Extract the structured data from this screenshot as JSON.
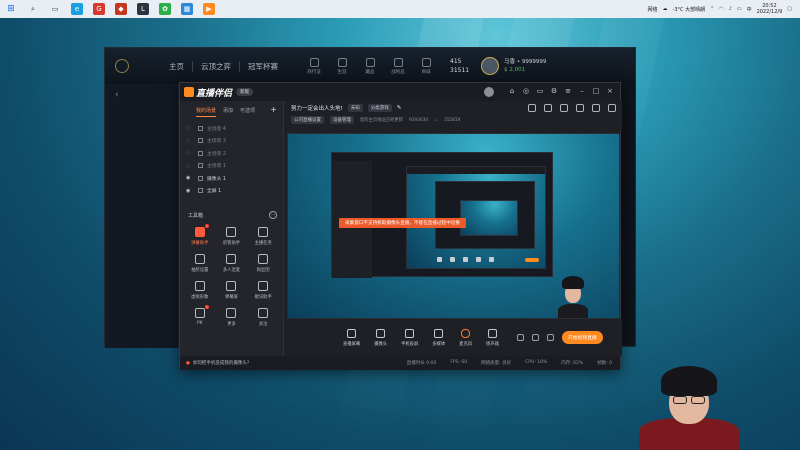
{
  "taskbar": {
    "wifi_label": "网络",
    "weather": "-3°C 大部晴朗",
    "time": "20:52",
    "date": "2022/12/9"
  },
  "client": {
    "nav": [
      "主页",
      "云顶之弈",
      "冠军杯赛"
    ],
    "icon_labels": [
      "商行证",
      "生涯",
      "藏品",
      "战利品",
      "商城"
    ],
    "stat1": "415",
    "stat2": "31511",
    "username": "马香 • 9999999",
    "user_sub": "$ 2,001"
  },
  "app": {
    "logo": "直播伴侣",
    "version_btn": "新版",
    "scene_tabs": [
      "我的场景",
      "添加",
      "可选项"
    ],
    "scenes": [
      {
        "label": "主场景 4",
        "visible": false
      },
      {
        "label": "主场景 3",
        "visible": false
      },
      {
        "label": "主场景 2",
        "visible": false
      },
      {
        "label": "主场景 1",
        "visible": false
      },
      {
        "label": "摄像头 1",
        "visible": true
      },
      {
        "label": "全屏 1",
        "visible": true
      }
    ],
    "tools_title": "工具箱",
    "tools": [
      "弹幕助手",
      "房管助手",
      "主播任务",
      "抽奖设置",
      "多人连麦",
      "粉丝团",
      "虚拟形象",
      "弹幕屏",
      "歌词助手",
      "PK",
      "更多",
      "关注"
    ],
    "stream_title": "努力一定会出人头地!",
    "category_chip": "未知",
    "tag_chip": "分类游戏",
    "meta_left": "公司直播设置",
    "meta_chip": "设备管理",
    "meta_id_label": "您的主页地址已经更新",
    "meta_id": "9293030",
    "meta_fans": "355819",
    "warning": "采集窗口不支持抓取摄像头直播，不能在直播过程中切换",
    "controls": [
      "直播屏幕",
      "摄像头",
      "手机投屏",
      "多媒体",
      "麦克风",
      "扬声器"
    ],
    "start_btn": "开始视频直播",
    "status_tip": "如何把手机变成我的摄像头?",
    "status_stats": [
      "直播时长 0:00",
      "FPS: 60",
      "网络质量: 良好",
      "CPU: 18%",
      "内存: 62%",
      "帧数: 0"
    ]
  },
  "colors": {
    "accent": "#ff8a1f",
    "warning_bg": "#ec5a2a"
  }
}
